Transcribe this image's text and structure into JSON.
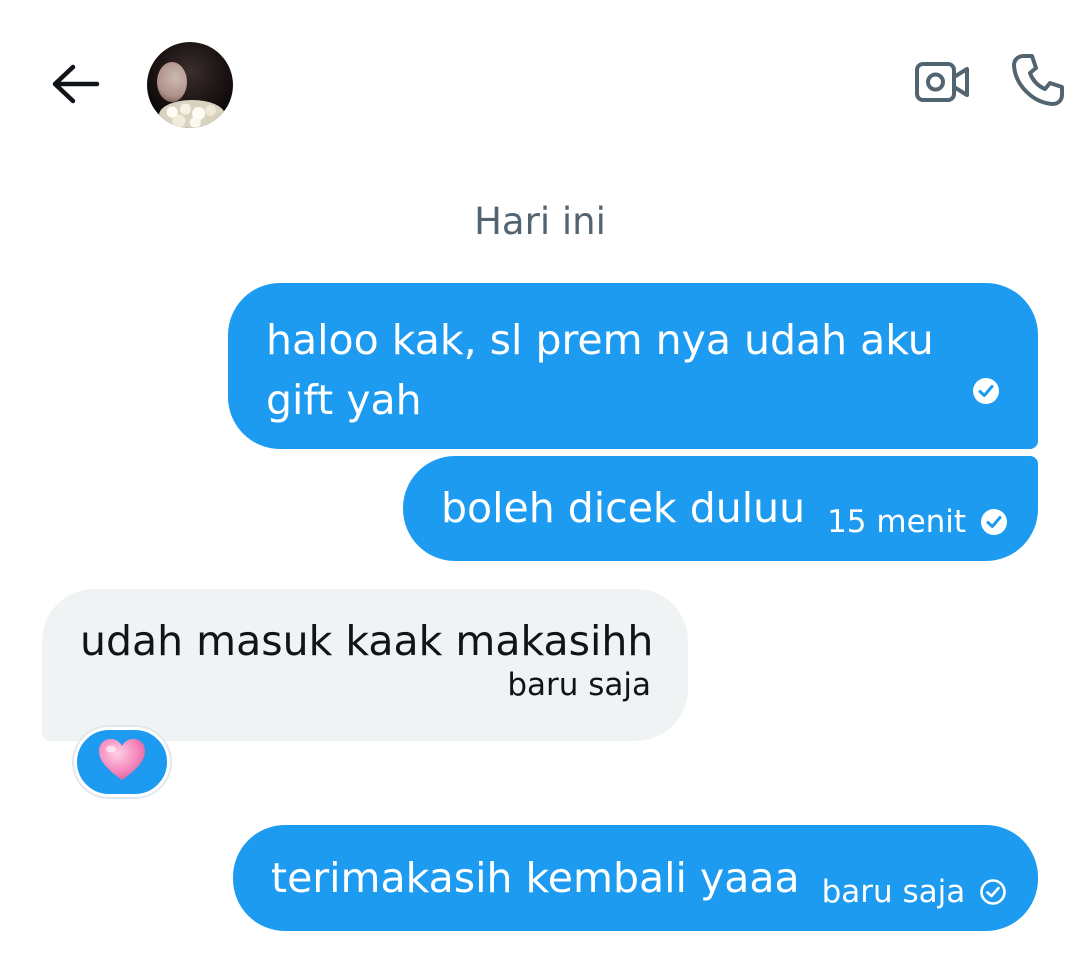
{
  "header": {
    "back_icon": "arrow-left-icon",
    "avatar_alt": "contact avatar",
    "video_icon": "video-camera-icon",
    "call_icon": "phone-icon"
  },
  "date_separator": "Hari ini",
  "messages": [
    {
      "direction": "outgoing",
      "text": "haloo kak, sl prem nya udah aku gift yah",
      "time": "",
      "status_icon": "read-check-icon"
    },
    {
      "direction": "outgoing",
      "text": "boleh dicek duluu",
      "time": "15 menit",
      "status_icon": "read-check-icon"
    },
    {
      "direction": "incoming",
      "text": "udah masuk kaak makasihh",
      "time": "baru saja",
      "reaction": "pink-heart-emoji"
    },
    {
      "direction": "outgoing",
      "text": "terimakasih kembali yaaa",
      "time": "baru saja",
      "status_icon": "sent-check-icon"
    }
  ],
  "colors": {
    "outgoing_bubble": "#1d9bf0",
    "incoming_bubble": "#eff3f4",
    "secondary_text": "#536471",
    "primary_text": "#0f1419",
    "heart": "#f78fc0"
  }
}
